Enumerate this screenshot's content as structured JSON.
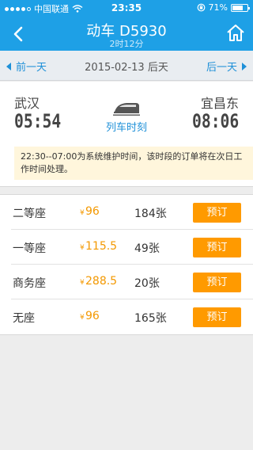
{
  "status_bar": {
    "carrier": "中国联通",
    "time": "23:35",
    "battery_percent": "71%",
    "battery_level": 0.71
  },
  "header": {
    "title": "动车 D5930",
    "duration": "2时12分"
  },
  "date_bar": {
    "prev_label": "前一天",
    "current": "2015-02-13 后天",
    "next_label": "后一天"
  },
  "journey": {
    "from_station": "武汉",
    "to_station": "宜昌东",
    "depart_time": "05:54",
    "arrive_time": "08:06",
    "schedule_link": "列车时刻"
  },
  "notice": "22:30--07:00为系统维护时间，该时段的订单将在次日工作时间处理。",
  "seats": [
    {
      "name": "二等座",
      "currency": "¥",
      "price": "96",
      "count": "184张",
      "button": "预订"
    },
    {
      "name": "一等座",
      "currency": "¥",
      "price": "115.5",
      "count": "49张",
      "button": "预订"
    },
    {
      "name": "商务座",
      "currency": "¥",
      "price": "288.5",
      "count": "20张",
      "button": "预订"
    },
    {
      "name": "无座",
      "currency": "¥",
      "price": "96",
      "count": "165张",
      "button": "预订"
    }
  ],
  "colors": {
    "header": "#1ea0e6",
    "accent": "#1e90d8",
    "price": "#f39800",
    "book_button": "#ff9a00",
    "notice_bg": "#fff6dc"
  }
}
